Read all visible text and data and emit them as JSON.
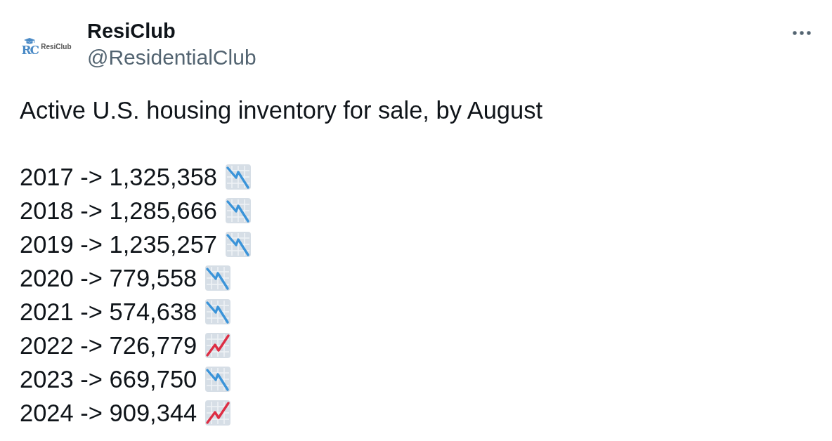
{
  "post": {
    "avatar": {
      "logo_mark": "RC",
      "logo_text": "ResiClub"
    },
    "display_name": "ResiClub",
    "handle": "@ResidentialClub",
    "text": "Active U.S. housing inventory for sale, by August",
    "lines": [
      {
        "text": "2017 -> 1,325,358",
        "kind": "decrease"
      },
      {
        "text": "2018 -> 1,285,666",
        "kind": "decrease"
      },
      {
        "text": "2019 -> 1,235,257",
        "kind": "decrease"
      },
      {
        "text": "2020 -> 779,558",
        "kind": "decrease"
      },
      {
        "text": "2021 -> 574,638",
        "kind": "decrease"
      },
      {
        "text": "2022 -> 726,779",
        "kind": "increase"
      },
      {
        "text": "2023 -> 669,750",
        "kind": "decrease"
      },
      {
        "text": "2024 -> 909,344",
        "kind": "increase"
      }
    ]
  }
}
